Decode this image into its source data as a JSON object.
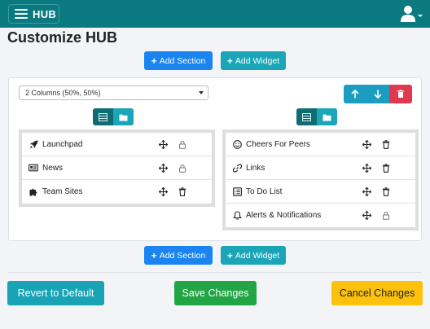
{
  "header": {
    "brand": "HUB"
  },
  "page": {
    "title": "Customize HUB"
  },
  "toolbar_top": {
    "add_section": "Add Section",
    "add_widget": "Add Widget"
  },
  "toolbar_bottom": {
    "add_section": "Add Section",
    "add_widget": "Add Widget"
  },
  "section": {
    "layout_select": "2 Columns (50%, 50%)",
    "left_column": [
      {
        "label": "Launchpad",
        "icon": "rocket-icon",
        "second_action": "lock-icon"
      },
      {
        "label": "News",
        "icon": "newspaper-icon",
        "second_action": "lock-icon"
      },
      {
        "label": "Team Sites",
        "icon": "puzzle-icon",
        "second_action": "trash-icon"
      }
    ],
    "right_column": [
      {
        "label": "Cheers For Peers",
        "icon": "smile-icon",
        "second_action": "trash-icon"
      },
      {
        "label": "Links",
        "icon": "link-icon",
        "second_action": "trash-icon"
      },
      {
        "label": "To Do List",
        "icon": "list-icon",
        "second_action": "trash-icon"
      },
      {
        "label": "Alerts & Notifications",
        "icon": "bell-icon",
        "second_action": "lock-icon"
      }
    ]
  },
  "footer": {
    "revert": "Revert to Default",
    "save": "Save Changes",
    "cancel": "Cancel Changes"
  },
  "colors": {
    "header": "#0b7a80",
    "primary": "#1a84f0",
    "teal": "#1aa5b8",
    "danger": "#e0394f",
    "success": "#22a545",
    "warning": "#fcc10a"
  }
}
